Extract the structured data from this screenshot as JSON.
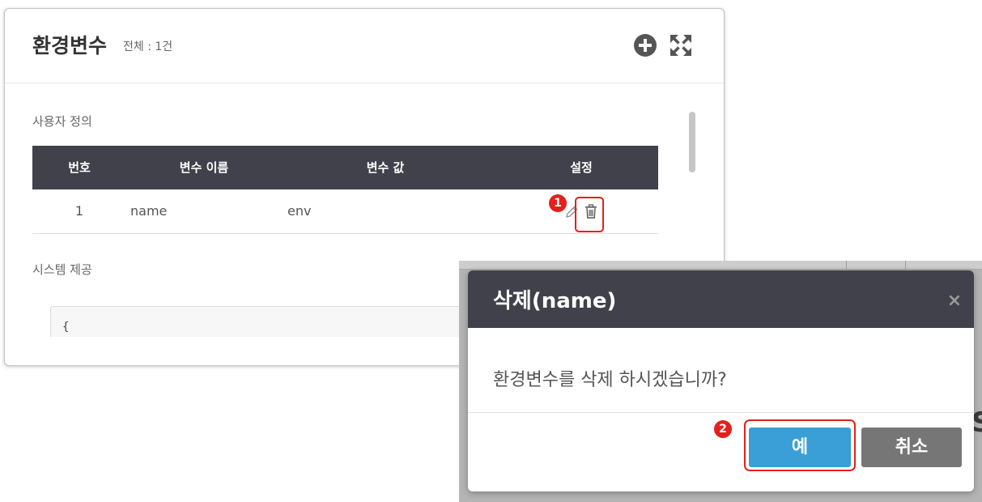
{
  "panel": {
    "title": "환경변수",
    "count_label": "전체 : 1건",
    "add_icon": "plus-circle-icon",
    "expand_icon": "expand-icon",
    "user_section": {
      "label": "사용자 정의",
      "columns": [
        "번호",
        "변수 이름",
        "변수 값",
        "설정"
      ],
      "rows": [
        {
          "no": "1",
          "name": "name",
          "value": "env",
          "actions": [
            "pencil-icon",
            "trash-icon"
          ]
        }
      ]
    },
    "system_section": {
      "label": "시스템 제공",
      "code_text": "{"
    }
  },
  "background": {
    "fragment_text": "S"
  },
  "dialog": {
    "title": "삭제(name)",
    "close_glyph": "×",
    "message": "환경변수를 삭제 하시겠습니까?",
    "confirm_label": "예",
    "cancel_label": "취소"
  },
  "annotations": [
    {
      "number": "1"
    },
    {
      "number": "2"
    }
  ],
  "colors": {
    "header_dark": "#40414b",
    "confirm_blue": "#3a9fd6",
    "cancel_gray": "#767676",
    "annotation_red": "#e3201b",
    "overlay_gray": "#b4b4b4"
  }
}
